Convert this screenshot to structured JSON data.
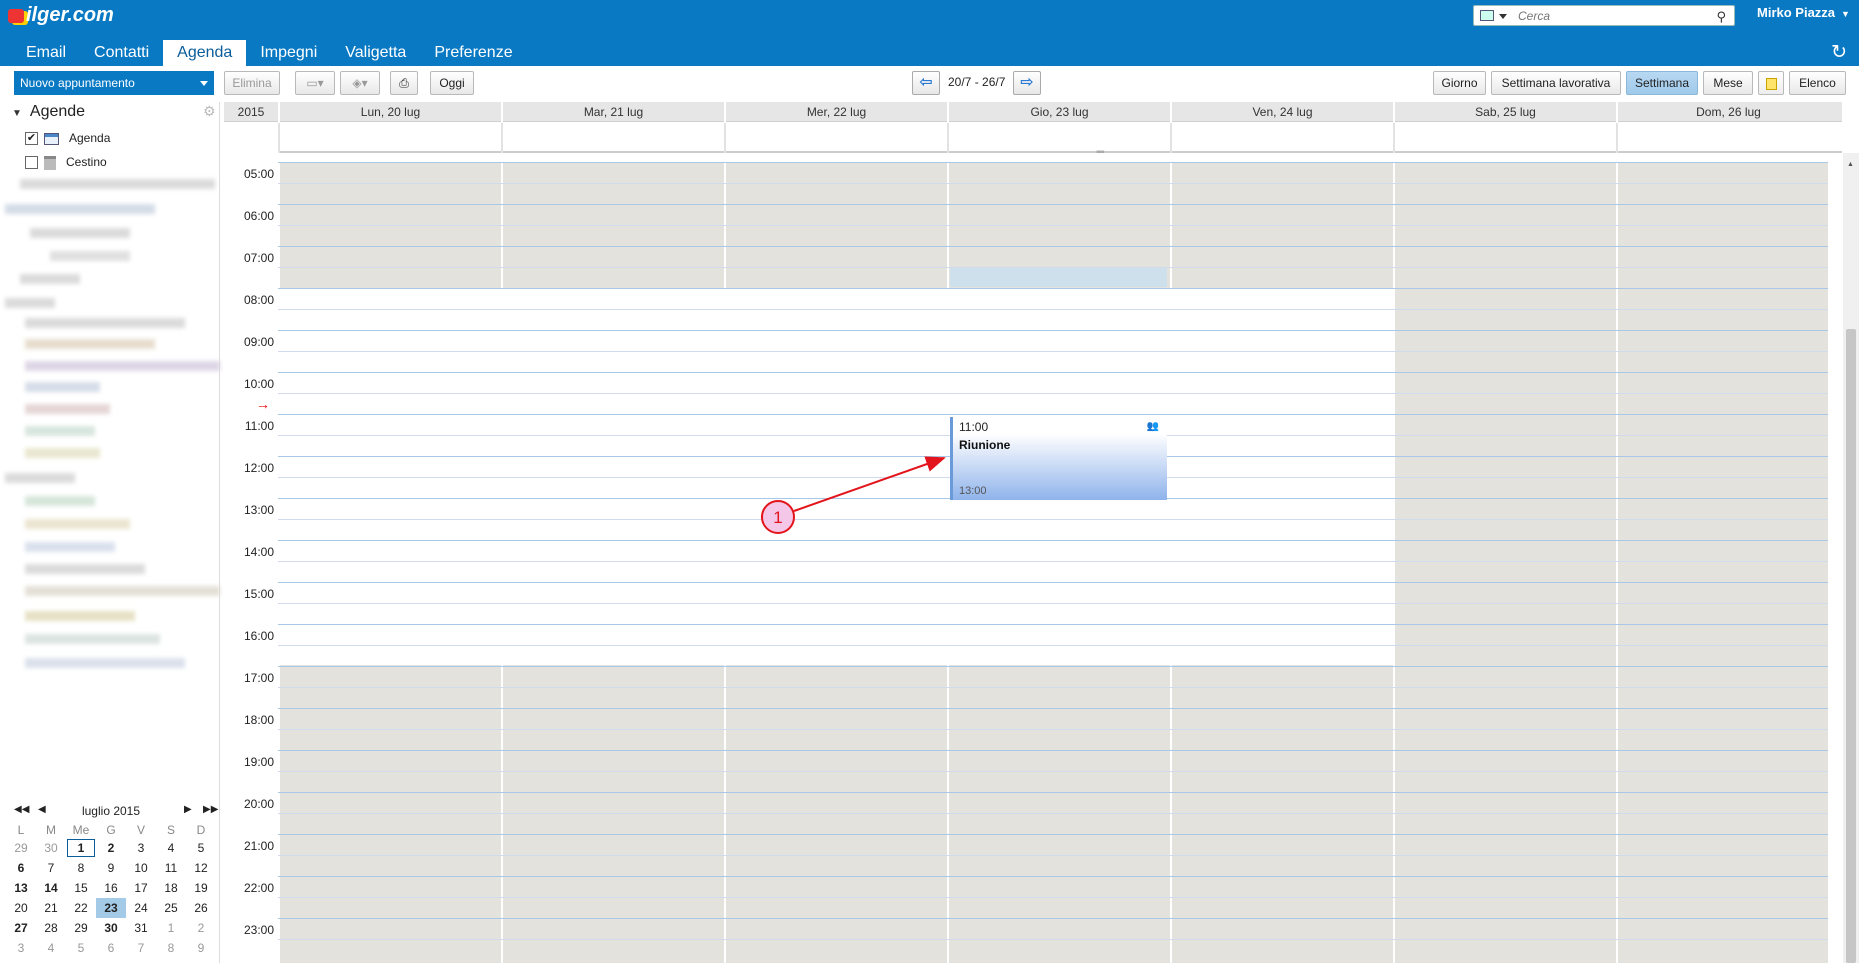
{
  "header": {
    "logo_text": "ilger.com",
    "search_placeholder": "Cerca",
    "user_name": "Mirko Piazza"
  },
  "nav": {
    "tabs": [
      {
        "label": "Email"
      },
      {
        "label": "Contatti"
      },
      {
        "label": "Agenda"
      },
      {
        "label": "Impegni"
      },
      {
        "label": "Valigetta"
      },
      {
        "label": "Preferenze"
      }
    ]
  },
  "toolbar": {
    "new_appointment": "Nuovo appuntamento",
    "delete": "Elimina",
    "today": "Oggi",
    "range": "20/7 - 26/7",
    "views": [
      "Giorno",
      "Settimana lavorativa",
      "Settimana",
      "Mese",
      "Elenco"
    ]
  },
  "sidebar": {
    "title": "Agende",
    "calendars": [
      {
        "label": "Agenda",
        "checked": true
      },
      {
        "label": "Cestino",
        "checked": false
      }
    ]
  },
  "minical": {
    "title": "luglio 2015",
    "weekdays": [
      "L",
      "M",
      "Me",
      "G",
      "V",
      "S",
      "D"
    ],
    "weeks": [
      [
        "29",
        "30",
        "1",
        "2",
        "3",
        "4",
        "5"
      ],
      [
        "6",
        "7",
        "8",
        "9",
        "10",
        "11",
        "12"
      ],
      [
        "13",
        "14",
        "15",
        "16",
        "17",
        "18",
        "19"
      ],
      [
        "20",
        "21",
        "22",
        "23",
        "24",
        "25",
        "26"
      ],
      [
        "27",
        "28",
        "29",
        "30",
        "31",
        "1",
        "2"
      ],
      [
        "3",
        "4",
        "5",
        "6",
        "7",
        "8",
        "9"
      ]
    ]
  },
  "week": {
    "year": "2015",
    "days": [
      "Lun, 20 lug",
      "Mar, 21 lug",
      "Mer, 22 lug",
      "Gio, 23 lug",
      "Ven, 24 lug",
      "Sab, 25 lug",
      "Dom, 26 lug"
    ],
    "hours": [
      "05:00",
      "06:00",
      "07:00",
      "08:00",
      "09:00",
      "10:00",
      "11:00",
      "12:00",
      "13:00",
      "14:00",
      "15:00",
      "16:00",
      "17:00",
      "18:00",
      "19:00",
      "20:00",
      "21:00",
      "22:00",
      "23:00"
    ]
  },
  "event": {
    "start": "11:00",
    "title": "Riunione",
    "end": "13:00"
  },
  "annotation": {
    "label": "1"
  }
}
